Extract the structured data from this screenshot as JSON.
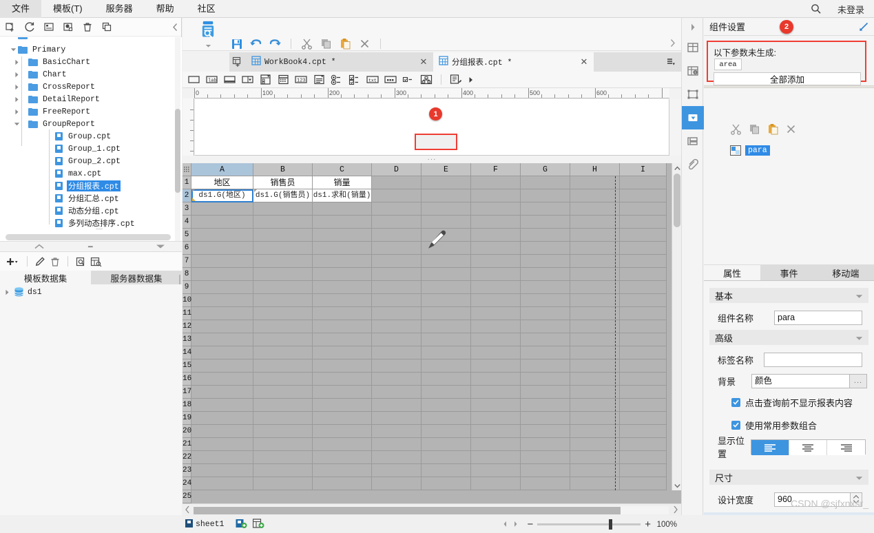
{
  "menu": {
    "items": [
      "文件",
      "模板(T)",
      "服务器",
      "帮助",
      "社区"
    ],
    "search_icon": "search-icon",
    "login_status": "未登录"
  },
  "left_panel": {
    "toolbar_icons": [
      "new-template-icon",
      "refresh-icon",
      "rename-icon",
      "config-icon",
      "delete-icon",
      "copy-icon"
    ],
    "collapse_icon": "chevron-left-icon",
    "tree": [
      {
        "label": "Primary",
        "type": "folder",
        "depth": 1,
        "expanded": true
      },
      {
        "label": "BasicChart",
        "type": "folder",
        "depth": 2,
        "expanded": false
      },
      {
        "label": "Chart",
        "type": "folder",
        "depth": 2,
        "expanded": false
      },
      {
        "label": "CrossReport",
        "type": "folder",
        "depth": 2,
        "expanded": false
      },
      {
        "label": "DetailReport",
        "type": "folder",
        "depth": 2,
        "expanded": false
      },
      {
        "label": "FreeReport",
        "type": "folder",
        "depth": 2,
        "expanded": false
      },
      {
        "label": "GroupReport",
        "type": "folder",
        "depth": 2,
        "expanded": true
      },
      {
        "label": "Group.cpt",
        "type": "cpt",
        "depth": 3,
        "selected": false
      },
      {
        "label": "Group_1.cpt",
        "type": "cpt",
        "depth": 3,
        "selected": false
      },
      {
        "label": "Group_2.cpt",
        "type": "cpt",
        "depth": 3,
        "selected": false
      },
      {
        "label": "max.cpt",
        "type": "cpt",
        "depth": 3,
        "selected": false
      },
      {
        "label": "分组报表.cpt",
        "type": "cpt",
        "depth": 3,
        "selected": true
      },
      {
        "label": "分组汇总.cpt",
        "type": "cpt",
        "depth": 3,
        "selected": false
      },
      {
        "label": "动态分组.cpt",
        "type": "cpt",
        "depth": 3,
        "selected": false
      },
      {
        "label": "多列动态排序.cpt",
        "type": "cpt",
        "depth": 3,
        "selected": false
      }
    ],
    "dataset_toolbar_icons": [
      "add-icon",
      "edit-icon",
      "delete-icon",
      "preview-icon",
      "search-dataset-icon"
    ],
    "dataset_tabs": [
      {
        "label": "模板数据集",
        "active": true
      },
      {
        "label": "服务器数据集",
        "active": false
      }
    ],
    "datasets": [
      {
        "label": "ds1",
        "icon": "database-icon"
      }
    ]
  },
  "center": {
    "toolbar": {
      "big_tool": "preview-template-icon",
      "icons": [
        "save-icon",
        "undo-icon",
        "redo-icon",
        "cut-icon",
        "copy-icon",
        "paste-icon",
        "delete-icon"
      ]
    },
    "tabs": [
      {
        "label": "WorkBook4.cpt *",
        "active": false,
        "close_icon": "close-icon"
      },
      {
        "label": "分组报表.cpt *",
        "active": true,
        "close_icon": "close-icon"
      }
    ],
    "tab_new_icon": "new-tab-icon",
    "tabs_overflow_icon": "tab-list-icon",
    "widget_icons": [
      "button-widget-icon",
      "label-widget-icon",
      "textfield-widget-icon",
      "combobox-widget-icon",
      "combo-checkbox-icon",
      "datepicker-widget-icon",
      "number-widget-icon",
      "textarea-widget-icon",
      "radiogroup-widget-icon",
      "checkboxgroup-widget-icon",
      "text-widget-icon",
      "password-widget-icon",
      "checkbox-widget-icon",
      "treebox-widget-icon",
      "custom-widget-icon",
      "more-widgets-arrow-icon"
    ],
    "ruler": {
      "labels": [
        "0",
        "100",
        "200",
        "300",
        "400",
        "500",
        "600"
      ],
      "v_label": "0"
    },
    "param_widget": {
      "name": "parameter-widget",
      "annotation_badge": "1"
    },
    "sheet": {
      "columns": [
        "A",
        "B",
        "C",
        "D",
        "E",
        "F",
        "G",
        "H",
        "I"
      ],
      "active_column": "A",
      "rows": [
        "1",
        "2",
        "3",
        "4",
        "5",
        "6",
        "7",
        "8",
        "9",
        "10",
        "11",
        "12",
        "13",
        "14",
        "15",
        "16",
        "17",
        "18",
        "19",
        "20",
        "21",
        "22",
        "23",
        "24",
        "25"
      ],
      "active_row": "2",
      "cells": [
        {
          "row": 1,
          "col": "A",
          "value": "地区",
          "style": "head"
        },
        {
          "row": 1,
          "col": "B",
          "value": "销售员",
          "style": "head"
        },
        {
          "row": 1,
          "col": "C",
          "value": "销量",
          "style": "head"
        },
        {
          "row": 2,
          "col": "A",
          "value": "ds1.G(地区)",
          "style": "formula-selected"
        },
        {
          "row": 2,
          "col": "B",
          "value": "ds1.G(销售员)",
          "style": "formula"
        },
        {
          "row": 2,
          "col": "C",
          "value": "ds1.求和(销量)",
          "style": "formula"
        }
      ],
      "watermark_icon": "pencil-icon"
    },
    "status": {
      "sheet_tab": "sheet1",
      "add_sheet_icon": "add-report-sheet-icon",
      "add_frm_icon": "add-form-sheet-icon",
      "prev_icon": "prev-sheet-icon",
      "next_icon": "next-sheet-icon",
      "zoom_out": "−",
      "zoom_in": "+",
      "zoom_level": "100%"
    }
  },
  "rail": {
    "icons": [
      {
        "name": "collapse-arrow-icon",
        "active": false
      },
      {
        "name": "cell-attributes-icon",
        "active": false
      },
      {
        "name": "cell-element-icon",
        "active": false
      },
      {
        "name": "frame-icon",
        "active": false
      },
      {
        "name": "widget-settings-icon",
        "active": true
      },
      {
        "name": "floating-element-icon",
        "active": false
      },
      {
        "name": "hyperlink-icon",
        "active": false
      }
    ]
  },
  "right_panel": {
    "header": {
      "title": "组件设置",
      "expand_icon": "expand-icon",
      "annotation_badge": "2"
    },
    "not_generated": {
      "label": "以下参数未生成:",
      "params": [
        "area"
      ],
      "add_all_label": "全部添加"
    },
    "clipboard_icons": [
      "cut-icon",
      "copy-icon",
      "paste-icon",
      "close-icon"
    ],
    "component": {
      "icon": "para-component-icon",
      "name": "para"
    },
    "tabs": [
      {
        "label": "属性",
        "active": true
      },
      {
        "label": "事件",
        "active": false
      },
      {
        "label": "移动端",
        "active": false
      }
    ],
    "sections": {
      "basic": {
        "title": "基本",
        "collapse_icon": "chevron-down-icon"
      },
      "advanced": {
        "title": "高级",
        "collapse_icon": "chevron-down-icon"
      },
      "size": {
        "title": "尺寸",
        "collapse_icon": "chevron-down-icon"
      }
    },
    "fields": {
      "component_name_label": "组件名称",
      "component_name_value": "para",
      "label_name_label": "标签名称",
      "label_name_value": "",
      "background_label": "背景",
      "background_value": "颜色",
      "background_more": "...",
      "checkbox_hide_label": "点击查询前不显示报表内容",
      "checkbox_common_label": "使用常用参数组合",
      "display_position_label": "显示位置",
      "align_options": [
        "align-left",
        "align-center",
        "align-right"
      ],
      "align_active": 0,
      "design_width_label": "设计宽度",
      "design_width_value": "960"
    }
  },
  "watermark": "CSDN @sjfxnxsr_",
  "colors": {
    "accent_blue": "#3d95e0",
    "selection_blue": "#2f8be6",
    "annotation_red": "#ef3d33",
    "panel_bg": "#f5f5f5",
    "grid_gray": "#b4b4b4"
  }
}
